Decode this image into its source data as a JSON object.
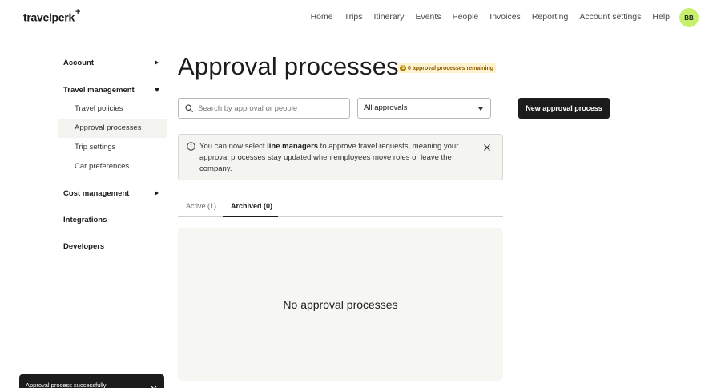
{
  "header": {
    "logo": "travelperk",
    "logo_mark": "+",
    "nav": [
      "Home",
      "Trips",
      "Itinerary",
      "Events",
      "People",
      "Invoices",
      "Reporting",
      "Account settings",
      "Help"
    ],
    "avatar_initials": "BB"
  },
  "sidebar": {
    "account": "Account",
    "travel_management": "Travel management",
    "travel_items": [
      "Travel policies",
      "Approval processes",
      "Trip settings",
      "Car preferences"
    ],
    "active_item": "Approval processes",
    "cost_management": "Cost management",
    "integrations": "Integrations",
    "developers": "Developers"
  },
  "main": {
    "title": "Approval processes",
    "remaining_badge": "0 approval processes remaining",
    "search_placeholder": "Search by approval or people",
    "filter_value": "All approvals",
    "new_button": "New approval process",
    "banner": {
      "part1": "You can now select ",
      "bold": "line managers",
      "part2": " to approve travel requests, meaning your approval processes stay updated when employees move roles or leave the company."
    },
    "tabs": {
      "active": "Active (1)",
      "archived": "Archived (0)"
    },
    "empty_text": "No approval processes"
  },
  "toast": {
    "text": "Approval process successfully"
  },
  "colors": {
    "accent": "#1c1c1c",
    "avatar": "#c6f06b",
    "badge_bg": "#fff2cf",
    "badge_text": "#8a5a00"
  }
}
